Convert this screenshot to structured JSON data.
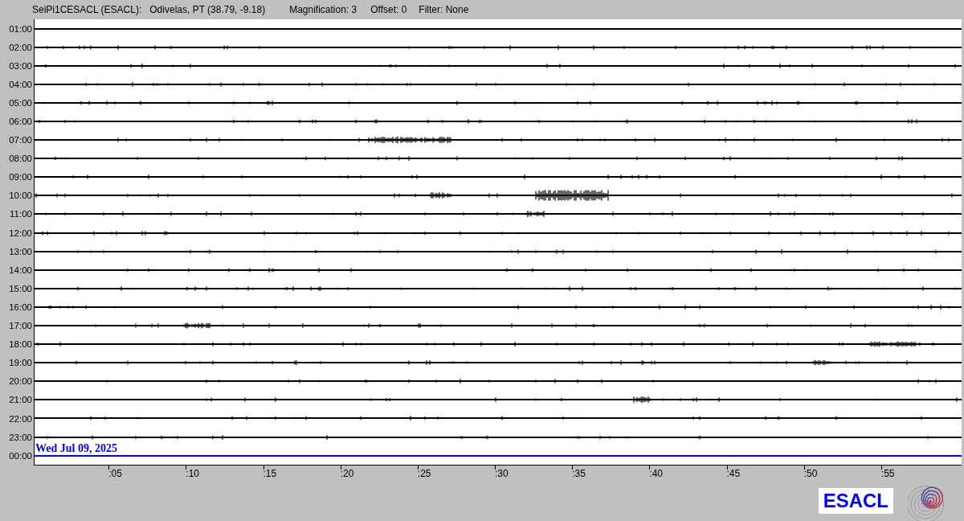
{
  "header": {
    "station": "SeiPi1CESACL (ESACL):",
    "location": "Odivelas, PT (38.79, -9.18)",
    "magnification": "Magnification: 3",
    "offset": "Offset: 0",
    "filter": "Filter: None"
  },
  "helicorder": {
    "rows": [
      {
        "time": "01:00",
        "kind": "trace"
      },
      {
        "time": "02:00",
        "kind": "trace"
      },
      {
        "time": "03:00",
        "kind": "trace"
      },
      {
        "time": "04:00",
        "kind": "trace"
      },
      {
        "time": "05:00",
        "kind": "trace"
      },
      {
        "time": "06:00",
        "kind": "trace"
      },
      {
        "time": "07:00",
        "kind": "trace"
      },
      {
        "time": "08:00",
        "kind": "trace"
      },
      {
        "time": "09:00",
        "kind": "trace"
      },
      {
        "time": "10:00",
        "kind": "trace"
      },
      {
        "time": "11:00",
        "kind": "trace"
      },
      {
        "time": "12:00",
        "kind": "trace"
      },
      {
        "time": "13:00",
        "kind": "trace"
      },
      {
        "time": "14:00",
        "kind": "trace"
      },
      {
        "time": "15:00",
        "kind": "trace"
      },
      {
        "time": "16:00",
        "kind": "trace"
      },
      {
        "time": "17:00",
        "kind": "trace"
      },
      {
        "time": "18:00",
        "kind": "trace"
      },
      {
        "time": "19:00",
        "kind": "trace"
      },
      {
        "time": "20:00",
        "kind": "trace"
      },
      {
        "time": "21:00",
        "kind": "trace"
      },
      {
        "time": "22:00",
        "kind": "trace"
      },
      {
        "time": "23:00",
        "kind": "trace"
      },
      {
        "time": "00:00",
        "kind": "current"
      }
    ],
    "date": "Wed Jul 09, 2025",
    "x_ticks": [
      ":05",
      ":10",
      ":15",
      ":20",
      ":25",
      ":30",
      ":35",
      ":40",
      ":45",
      ":50",
      ":55"
    ]
  },
  "logo": {
    "text": "ESACL"
  }
}
